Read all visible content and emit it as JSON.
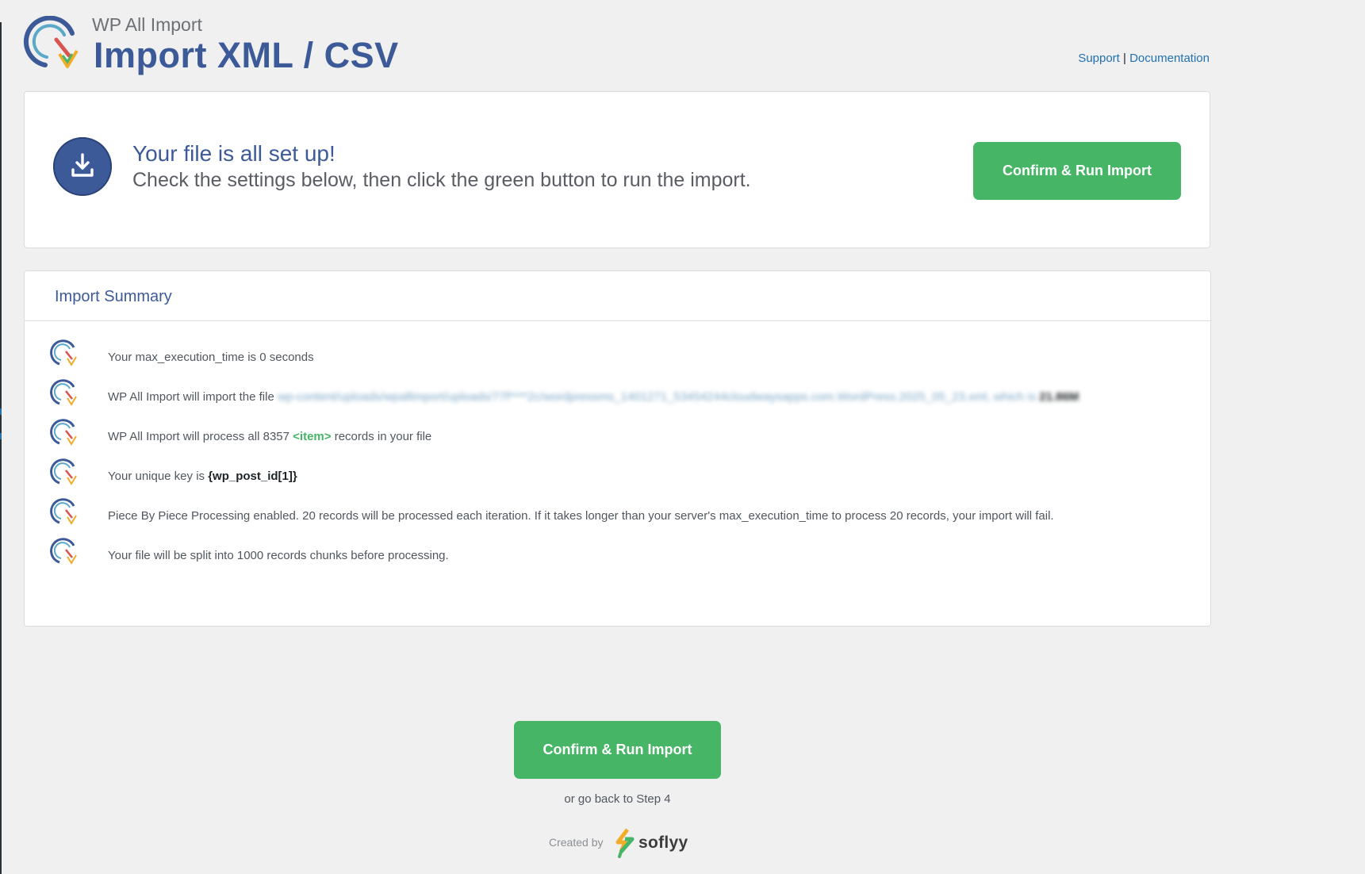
{
  "header": {
    "brand": "WP All Import",
    "title": "Import XML / CSV",
    "links": {
      "support": "Support",
      "separator": " | ",
      "documentation": "Documentation"
    }
  },
  "setup_card": {
    "title": "Your file is all set up!",
    "subtitle": "Check the settings below, then click the green button to run the import.",
    "confirm_button": "Confirm & Run Import",
    "icon": "download-icon"
  },
  "summary": {
    "heading": "Import Summary",
    "items": {
      "max_exec": "Your max_execution_time is 0 seconds",
      "file_prefix": "WP All Import will import the file ",
      "file_path": "wp-content/uploads/wpallimport/uploads/77f****2c/wordpressms_1401271_53454244cloudwaysapps.com.WordPress.2025_05_23.xml",
      "file_which_is": ", which is ",
      "file_size": "21.86M",
      "process_prefix": "WP All Import will process all 8357 ",
      "process_tag": "<item>",
      "process_suffix": " records in your file",
      "key_prefix": "Your unique key is ",
      "key_value": "{wp_post_id[1]}",
      "pbp": "Piece By Piece Processing enabled. 20 records will be processed each iteration. If it takes longer than your server's max_execution_time to process 20 records, your import will fail.",
      "split": "Your file will be split into 1000 records chunks before processing."
    }
  },
  "footer": {
    "confirm_button": "Confirm & Run Import",
    "back_link": "or go back to Step 4",
    "created_by": "Created by",
    "soflyy": "soflyy"
  },
  "colors": {
    "brand_blue": "#3d5a98",
    "confirm_green": "#46b566",
    "link_blue": "#2271b1",
    "page_bg": "#f0f0f1"
  }
}
